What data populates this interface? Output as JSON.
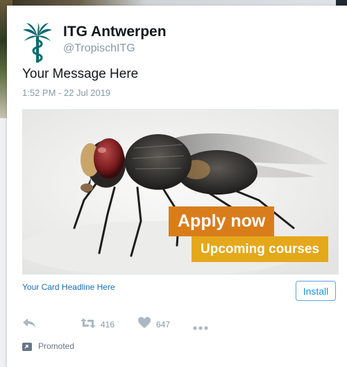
{
  "account": {
    "name": "ITG Antwerpen",
    "handle": "@TropischITG",
    "avatar_icon": "palm-snake-logo-icon"
  },
  "tweet": {
    "message": "Your Message Here",
    "timestamp": "1:52 PM - 22 Jul 2019"
  },
  "media": {
    "image": "housefly-photo",
    "apply_text": "Apply now",
    "upcoming_text": "Upcoming courses"
  },
  "card": {
    "headline": "Your Card Headline Here",
    "install_label": "Install"
  },
  "actions": {
    "reply_icon": "reply-icon",
    "retweet_icon": "retweet-icon",
    "retweet_count": "416",
    "like_icon": "heart-icon",
    "like_count": "647",
    "more_icon": "more-icon"
  },
  "promoted": {
    "icon": "promoted-icon",
    "label": "Promoted"
  },
  "colors": {
    "brand_teal": "#0e6b6f",
    "apply_orange": "#d97d1b",
    "upcoming_yellow": "#e4a81a",
    "link_blue": "#1b95e0"
  }
}
